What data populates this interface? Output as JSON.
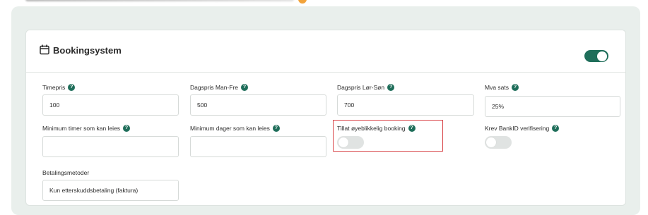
{
  "header": {
    "title": "Bookingsystem",
    "enabled": true
  },
  "fields": {
    "timepris": {
      "label": "Timepris",
      "value": "100"
    },
    "dagspris_man_fre": {
      "label": "Dagspris Man-Fre",
      "value": "500"
    },
    "dagspris_lor_son": {
      "label": "Dagspris Lør-Søn",
      "value": "700"
    },
    "mva_sats": {
      "label": "Mva sats",
      "value": "25%"
    },
    "min_timer": {
      "label": "Minimum timer som kan leies",
      "value": ""
    },
    "min_dager": {
      "label": "Minimum dager som kan leies",
      "value": ""
    },
    "tillat_booking": {
      "label": "Tillat øyeblikkelig booking",
      "enabled": false
    },
    "krev_bankid": {
      "label": "Krev BankID verifisering",
      "enabled": false
    },
    "betalingsmetoder": {
      "label": "Betalingsmetoder",
      "value": "Kun etterskuddsbetaling (faktura)"
    }
  },
  "help_glyph": "?",
  "colors": {
    "accent": "#1f6e5a",
    "highlight_border": "#d9464a",
    "outer_background": "#e9efec"
  },
  "icons": {
    "header": "calendar-icon",
    "help": "help-icon"
  }
}
